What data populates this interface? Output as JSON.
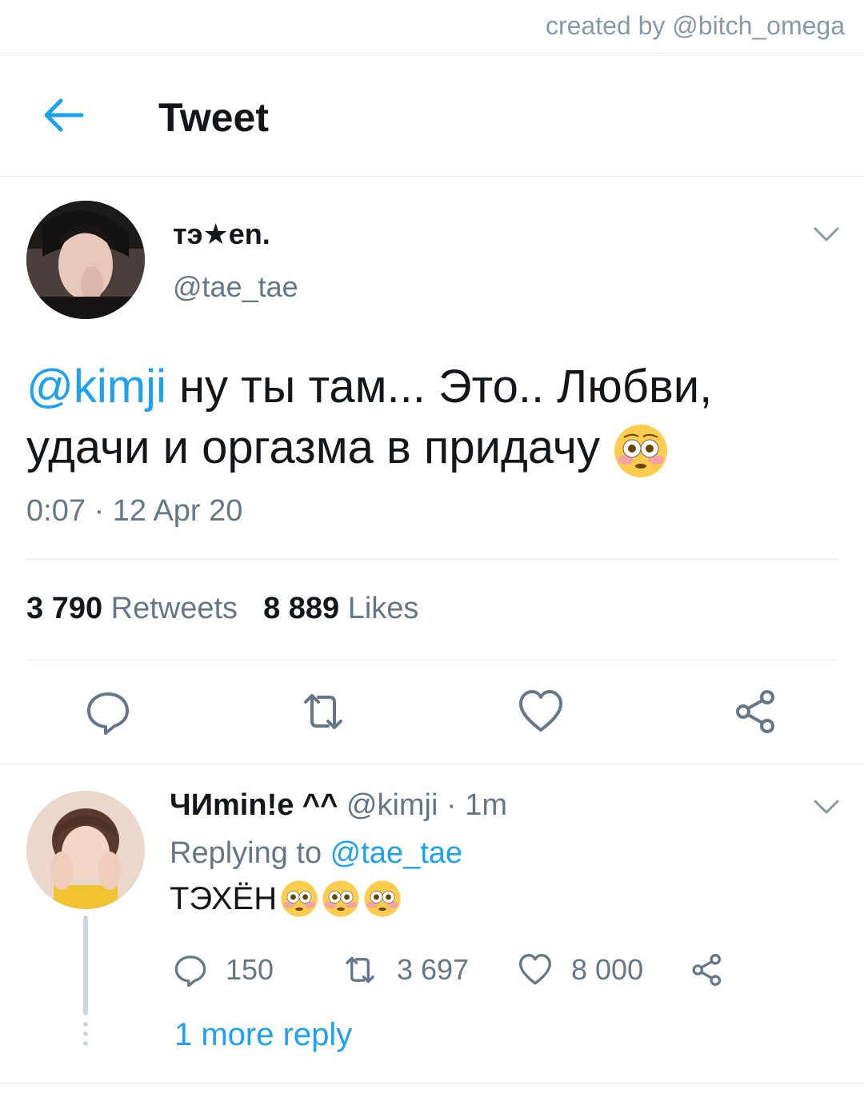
{
  "credit": "created by @bitch_omega",
  "header": {
    "title": "Tweet"
  },
  "tweet": {
    "author_name": "тэ★еn.",
    "author_handle": "@tae_tae",
    "mention": "@kimji",
    "text_line1": " ну ты там... Это.. Любви,",
    "text_line2": "удачи и оргазма в придачу ",
    "timestamp": "0:07 · 12 Apr 20",
    "retweets_count": "3 790",
    "retweets_label": "Retweets",
    "likes_count": "8 889",
    "likes_label": "Likes"
  },
  "reply": {
    "author_name": "ЧИmin!e ^^",
    "handle_time": "@kimji · 1m",
    "replying_label": "Replying to ",
    "replying_to": "@tae_tae",
    "text": "ТЭХЁН",
    "emoji_count": 3,
    "replies": "150",
    "retweets": "3 697",
    "likes": "8 000",
    "more_replies": "1 more reply"
  },
  "colors": {
    "accent": "#1da1f2",
    "secondary_text": "#657786",
    "divider": "#e1e8ed",
    "icon": "#657786"
  }
}
